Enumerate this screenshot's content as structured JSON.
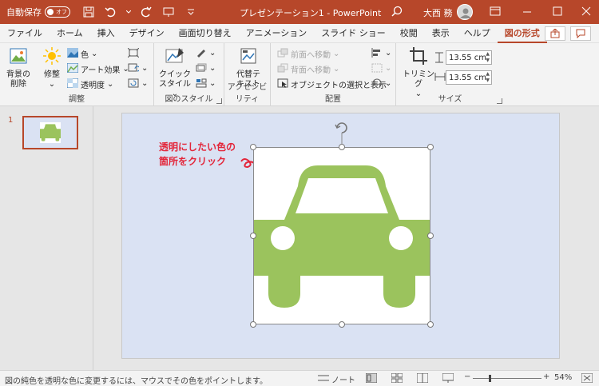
{
  "titlebar": {
    "autosave_label": "自動保存",
    "autosave_state": "オフ",
    "doc_title": "プレゼンテーション1 - PowerPoint",
    "user_name": "大西 務"
  },
  "tabs": [
    {
      "label": "ファイル"
    },
    {
      "label": "ホーム"
    },
    {
      "label": "挿入"
    },
    {
      "label": "デザイン"
    },
    {
      "label": "画面切り替え"
    },
    {
      "label": "アニメーション"
    },
    {
      "label": "スライド ショー"
    },
    {
      "label": "校閲"
    },
    {
      "label": "表示"
    },
    {
      "label": "ヘルプ"
    },
    {
      "label": "図の形式",
      "active": true
    }
  ],
  "ribbon": {
    "adjust": {
      "remove_bg_line1": "背景の",
      "remove_bg_line2": "削除",
      "corrections": "修整",
      "color": "色",
      "artistic": "アート効果",
      "transparency": "透明度",
      "label": "調整"
    },
    "styles": {
      "quick_line1": "クイック",
      "quick_line2": "スタイル",
      "label": "図のスタイル"
    },
    "accessibility": {
      "alt_line1": "代替テ",
      "alt_line2": "キスト",
      "label": "アクセシビリティ"
    },
    "arrange": {
      "bring_forward": "前面へ移動",
      "send_backward": "背面へ移動",
      "selection_pane": "オブジェクトの選択と表示",
      "label": "配置"
    },
    "size": {
      "crop": "トリミング",
      "height": "13.55 cm",
      "width": "13.55 cm",
      "label": "サイズ"
    }
  },
  "thumbnails": [
    {
      "number": "1"
    }
  ],
  "slide": {
    "annotation_line1": "透明にしたい色の",
    "annotation_line2": "箇所をクリック",
    "car_color": "#9bc35d",
    "background_color": "#dae2f3"
  },
  "statusbar": {
    "message": "図の純色を透明な色に変更するには、マウスでその色をポイントします。",
    "notes": "ノート",
    "zoom": "54%"
  },
  "colors": {
    "accent": "#b7472a",
    "annotation": "#e3263a"
  }
}
